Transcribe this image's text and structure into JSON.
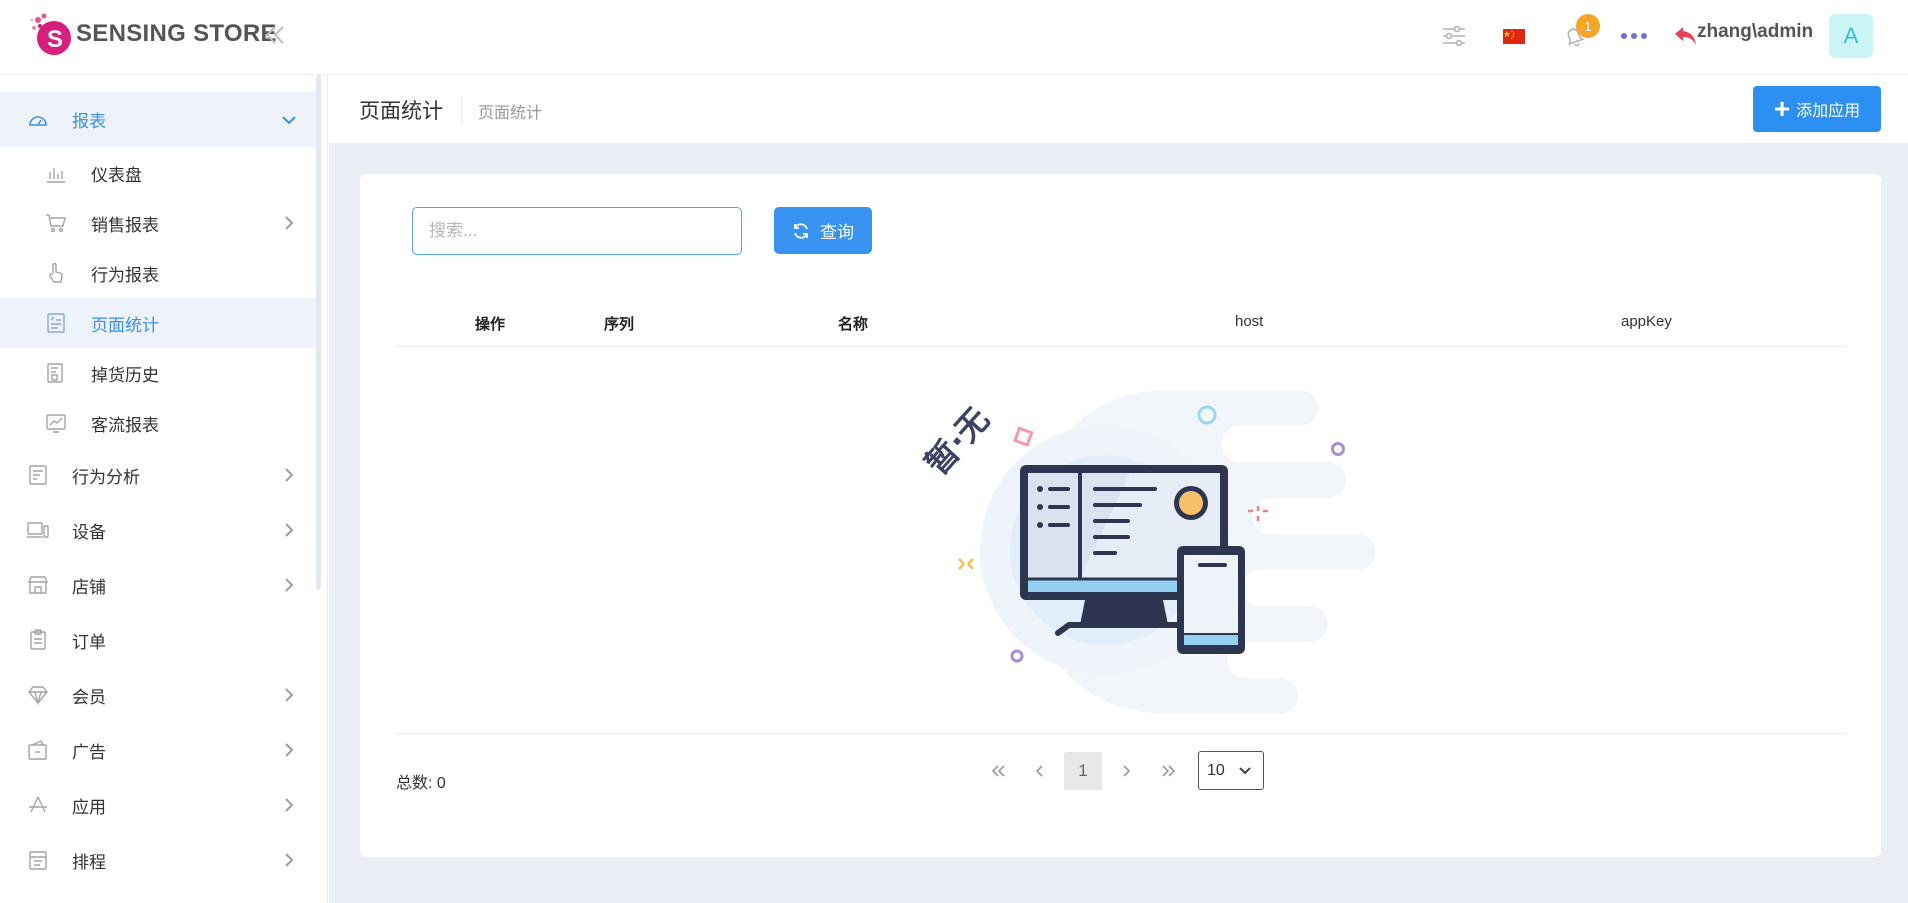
{
  "brand": {
    "name": "SENSING STORE"
  },
  "header": {
    "notification_count": "1",
    "user": "zhang\\admin",
    "avatar_letter": "A"
  },
  "sidebar": {
    "reports": {
      "label": "报表"
    },
    "report_items": [
      {
        "label": "仪表盘"
      },
      {
        "label": "销售报表"
      },
      {
        "label": "行为报表"
      },
      {
        "label": "页面统计"
      },
      {
        "label": "掉货历史"
      },
      {
        "label": "客流报表"
      }
    ],
    "items": [
      {
        "label": "行为分析"
      },
      {
        "label": "设备"
      },
      {
        "label": "店铺"
      },
      {
        "label": "订单"
      },
      {
        "label": "会员"
      },
      {
        "label": "广告"
      },
      {
        "label": "应用"
      },
      {
        "label": "排程"
      }
    ]
  },
  "page": {
    "title": "页面统计",
    "breadcrumb": "页面统计",
    "add_button": "添加应用"
  },
  "search": {
    "placeholder": "搜索..."
  },
  "query_button": "查询",
  "table": {
    "columns": [
      "操作",
      "序列",
      "名称",
      "host",
      "appKey"
    ],
    "empty_text": "暂·无"
  },
  "pagination": {
    "total": "总数: 0",
    "current_page": "1",
    "page_size": "10"
  },
  "colors": {
    "primary": "#2e8ff3",
    "active_bg": "#eef3fb",
    "page_bg": "#eceef5",
    "badge": "#f5a623"
  }
}
